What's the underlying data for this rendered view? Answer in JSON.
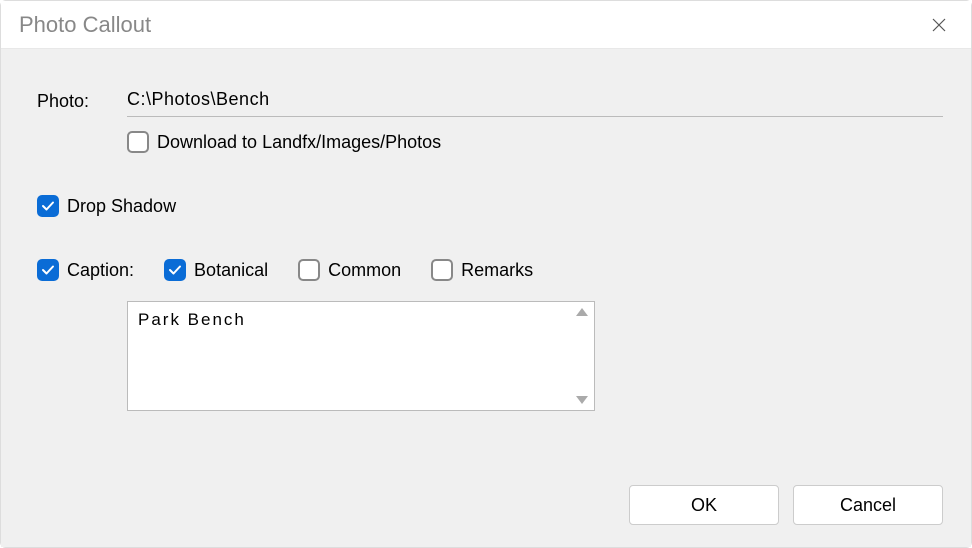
{
  "title": "Photo Callout",
  "photo": {
    "label": "Photo:",
    "path": "C:\\Photos\\Bench"
  },
  "download": {
    "checked": false,
    "label": "Download to Landfx/Images/Photos"
  },
  "dropShadow": {
    "checked": true,
    "label": "Drop Shadow"
  },
  "caption": {
    "checked": true,
    "label": "Caption:",
    "botanical": {
      "checked": true,
      "label": "Botanical"
    },
    "common": {
      "checked": false,
      "label": "Common"
    },
    "remarks": {
      "checked": false,
      "label": "Remarks"
    },
    "text": "Park Bench"
  },
  "buttons": {
    "ok": "OK",
    "cancel": "Cancel"
  }
}
